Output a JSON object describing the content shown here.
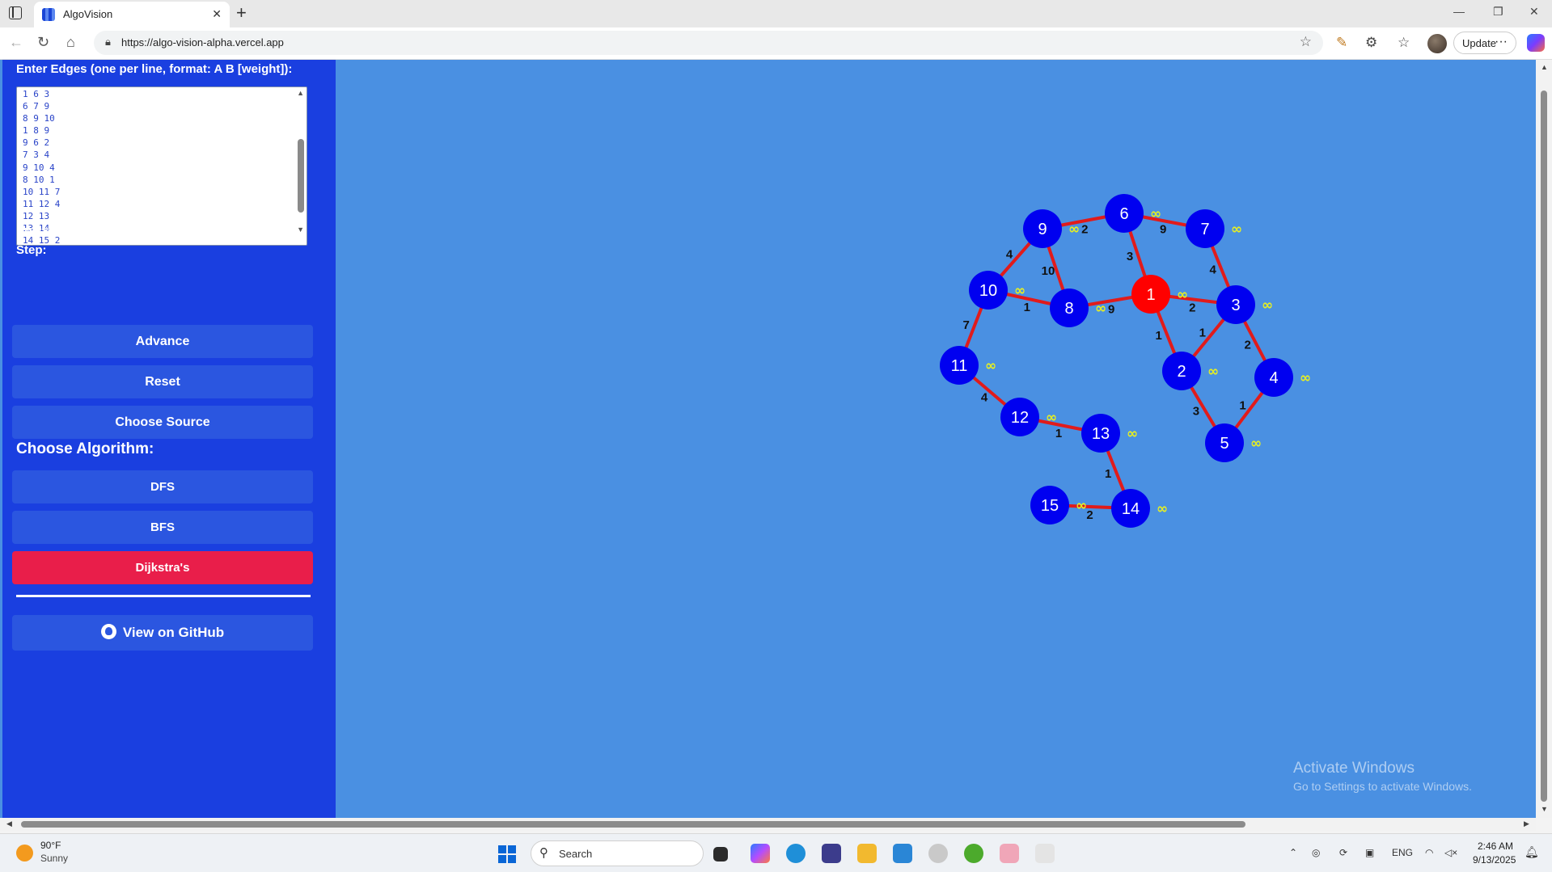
{
  "browser": {
    "tab_title": "AlgoVision",
    "tab_close": "✕",
    "new_tab": "+",
    "url": "https://algo-vision-alpha.vercel.app",
    "update_label": "Update",
    "more": "···",
    "window_controls": {
      "minimize": "—",
      "restore": "❐",
      "close": "✕"
    }
  },
  "sidebar": {
    "edges_label": "Enter Edges (one per line, format: A B [weight]):",
    "edges_value": "1 6 3\n6 7 9\n8 9 10\n1 8 9\n9 6 2\n7 3 4\n9 10 4\n8 10 1\n10 11 7\n11 12 4\n12 13\n13 14\n14 15 2",
    "advance_label": "Press (Advance) to Advance Algorithm Step by Step:",
    "advance_btn": "Advance",
    "reset_btn": "Reset",
    "choose_source_btn": "Choose Source",
    "algorithm_heading": "Choose Algorithm:",
    "algorithms": [
      "DFS",
      "BFS",
      "Dijkstra's"
    ],
    "active_algorithm": "Dijkstra's",
    "github_btn": "View on GitHub"
  },
  "graph": {
    "source": "1",
    "distance_label": "∞",
    "nodes": [
      "1",
      "2",
      "3",
      "4",
      "5",
      "6",
      "7",
      "8",
      "9",
      "10",
      "11",
      "12",
      "13",
      "14",
      "15"
    ],
    "edges": [
      {
        "from": "9",
        "to": "6",
        "weight": "2"
      },
      {
        "from": "6",
        "to": "7",
        "weight": "9"
      },
      {
        "from": "9",
        "to": "10",
        "weight": "4"
      },
      {
        "from": "9",
        "to": "8",
        "weight": "10"
      },
      {
        "from": "6",
        "to": "1",
        "weight": "3"
      },
      {
        "from": "7",
        "to": "3",
        "weight": "4"
      },
      {
        "from": "10",
        "to": "8",
        "weight": "1"
      },
      {
        "from": "8",
        "to": "1",
        "weight": "9"
      },
      {
        "from": "1",
        "to": "3",
        "weight": "2"
      },
      {
        "from": "10",
        "to": "11",
        "weight": "7"
      },
      {
        "from": "1",
        "to": "2",
        "weight": "1"
      },
      {
        "from": "3",
        "to": "2",
        "weight": "1"
      },
      {
        "from": "3",
        "to": "4",
        "weight": "2"
      },
      {
        "from": "11",
        "to": "12",
        "weight": "4"
      },
      {
        "from": "2",
        "to": "5",
        "weight": "3"
      },
      {
        "from": "4",
        "to": "5",
        "weight": "1"
      },
      {
        "from": "12",
        "to": "13",
        "weight": "1"
      },
      {
        "from": "13",
        "to": "14",
        "weight": "1"
      },
      {
        "from": "15",
        "to": "14",
        "weight": "2"
      }
    ]
  },
  "watermark": {
    "title": "Activate Windows",
    "subtitle": "Go to Settings to activate Windows."
  },
  "taskbar": {
    "temperature": "90°F",
    "weather": "Sunny",
    "search_placeholder": "Search",
    "language": "ENG",
    "time": "2:46 AM",
    "date": "9/13/2025"
  },
  "colors": {
    "sidebar": "#1a3fe0",
    "canvas": "#4a90e2",
    "node": "#0000f0",
    "source_node": "#ff0000",
    "edge": "#e11b1b",
    "active_button": "#e91e4a"
  }
}
